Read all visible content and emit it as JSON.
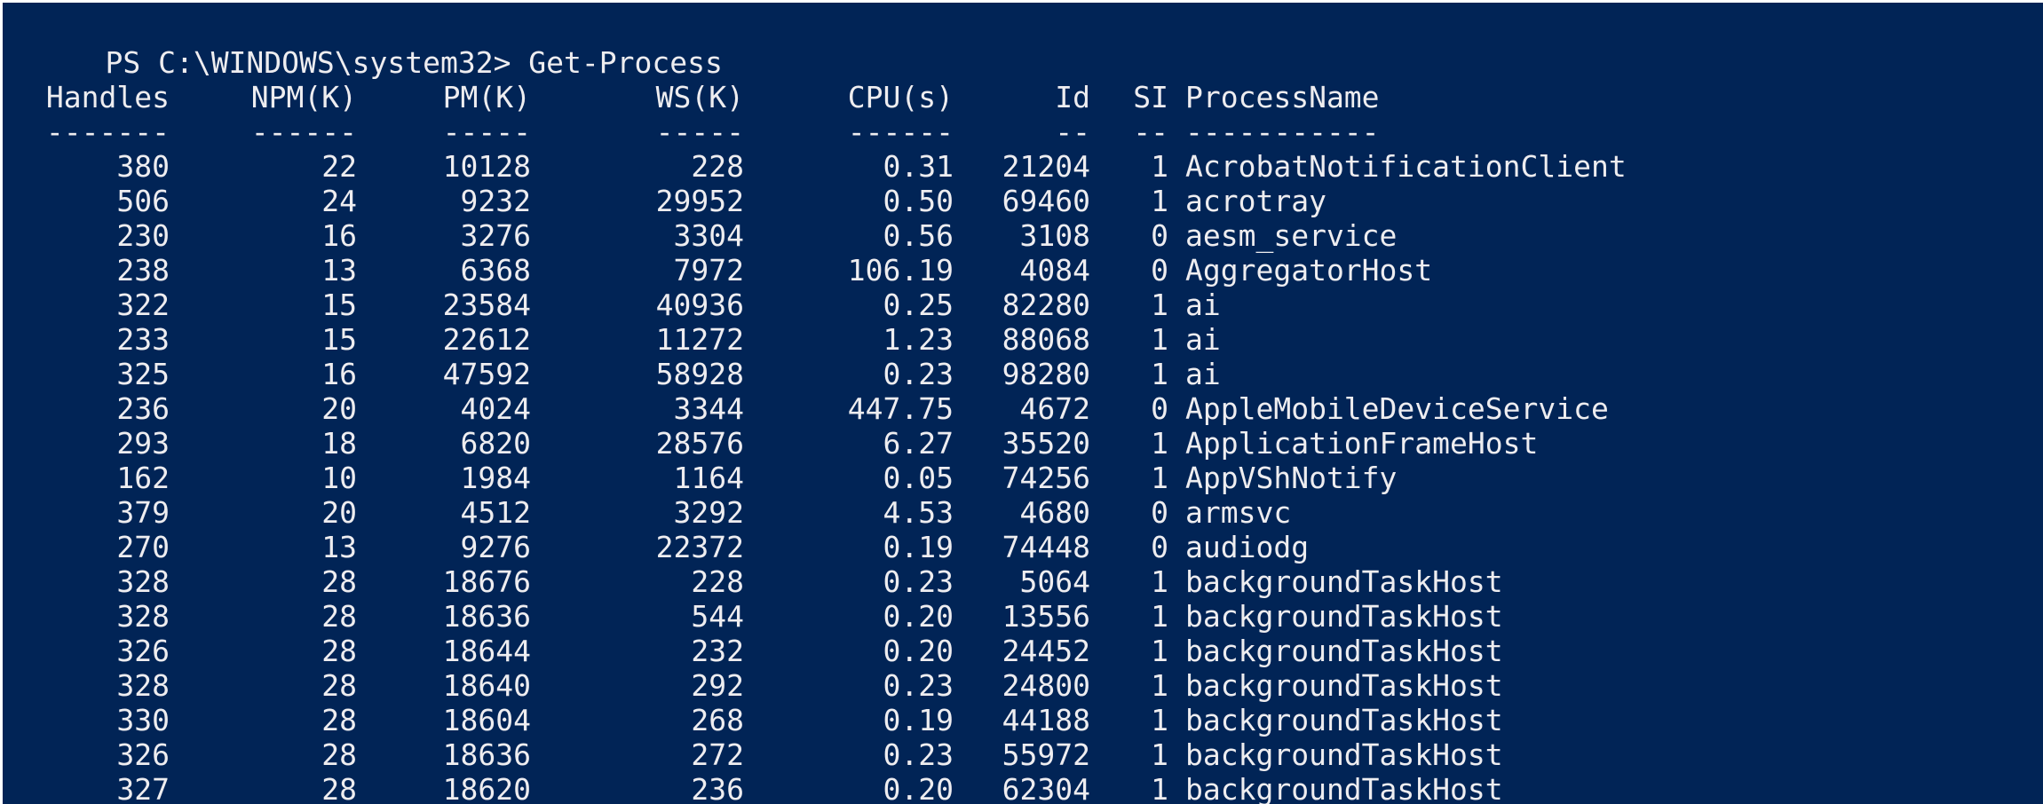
{
  "prompt": "PS C:\\WINDOWS\\system32> Get-Process",
  "columns": [
    "Handles",
    "NPM(K)",
    "PM(K)",
    "WS(K)",
    "CPU(s)",
    "Id",
    "SI",
    "ProcessName"
  ],
  "separators": [
    "-------",
    "------",
    "-----",
    "-----",
    "------",
    "--",
    "--",
    "-----------"
  ],
  "rows": [
    [
      "380",
      "22",
      "10128",
      "228",
      "0.31",
      "21204",
      "1",
      "AcrobatNotificationClient"
    ],
    [
      "506",
      "24",
      "9232",
      "29952",
      "0.50",
      "69460",
      "1",
      "acrotray"
    ],
    [
      "230",
      "16",
      "3276",
      "3304",
      "0.56",
      "3108",
      "0",
      "aesm_service"
    ],
    [
      "238",
      "13",
      "6368",
      "7972",
      "106.19",
      "4084",
      "0",
      "AggregatorHost"
    ],
    [
      "322",
      "15",
      "23584",
      "40936",
      "0.25",
      "82280",
      "1",
      "ai"
    ],
    [
      "233",
      "15",
      "22612",
      "11272",
      "1.23",
      "88068",
      "1",
      "ai"
    ],
    [
      "325",
      "16",
      "47592",
      "58928",
      "0.23",
      "98280",
      "1",
      "ai"
    ],
    [
      "236",
      "20",
      "4024",
      "3344",
      "447.75",
      "4672",
      "0",
      "AppleMobileDeviceService"
    ],
    [
      "293",
      "18",
      "6820",
      "28576",
      "6.27",
      "35520",
      "1",
      "ApplicationFrameHost"
    ],
    [
      "162",
      "10",
      "1984",
      "1164",
      "0.05",
      "74256",
      "1",
      "AppVShNotify"
    ],
    [
      "379",
      "20",
      "4512",
      "3292",
      "4.53",
      "4680",
      "0",
      "armsvc"
    ],
    [
      "270",
      "13",
      "9276",
      "22372",
      "0.19",
      "74448",
      "0",
      "audiodg"
    ],
    [
      "328",
      "28",
      "18676",
      "228",
      "0.23",
      "5064",
      "1",
      "backgroundTaskHost"
    ],
    [
      "328",
      "28",
      "18636",
      "544",
      "0.20",
      "13556",
      "1",
      "backgroundTaskHost"
    ],
    [
      "326",
      "28",
      "18644",
      "232",
      "0.20",
      "24452",
      "1",
      "backgroundTaskHost"
    ],
    [
      "328",
      "28",
      "18640",
      "292",
      "0.23",
      "24800",
      "1",
      "backgroundTaskHost"
    ],
    [
      "330",
      "28",
      "18604",
      "268",
      "0.19",
      "44188",
      "1",
      "backgroundTaskHost"
    ],
    [
      "326",
      "28",
      "18636",
      "272",
      "0.23",
      "55972",
      "1",
      "backgroundTaskHost"
    ],
    [
      "327",
      "28",
      "18620",
      "236",
      "0.20",
      "62304",
      "1",
      "backgroundTaskHost"
    ]
  ],
  "colors": {
    "background": "#012456",
    "text": "#eeedf0"
  }
}
